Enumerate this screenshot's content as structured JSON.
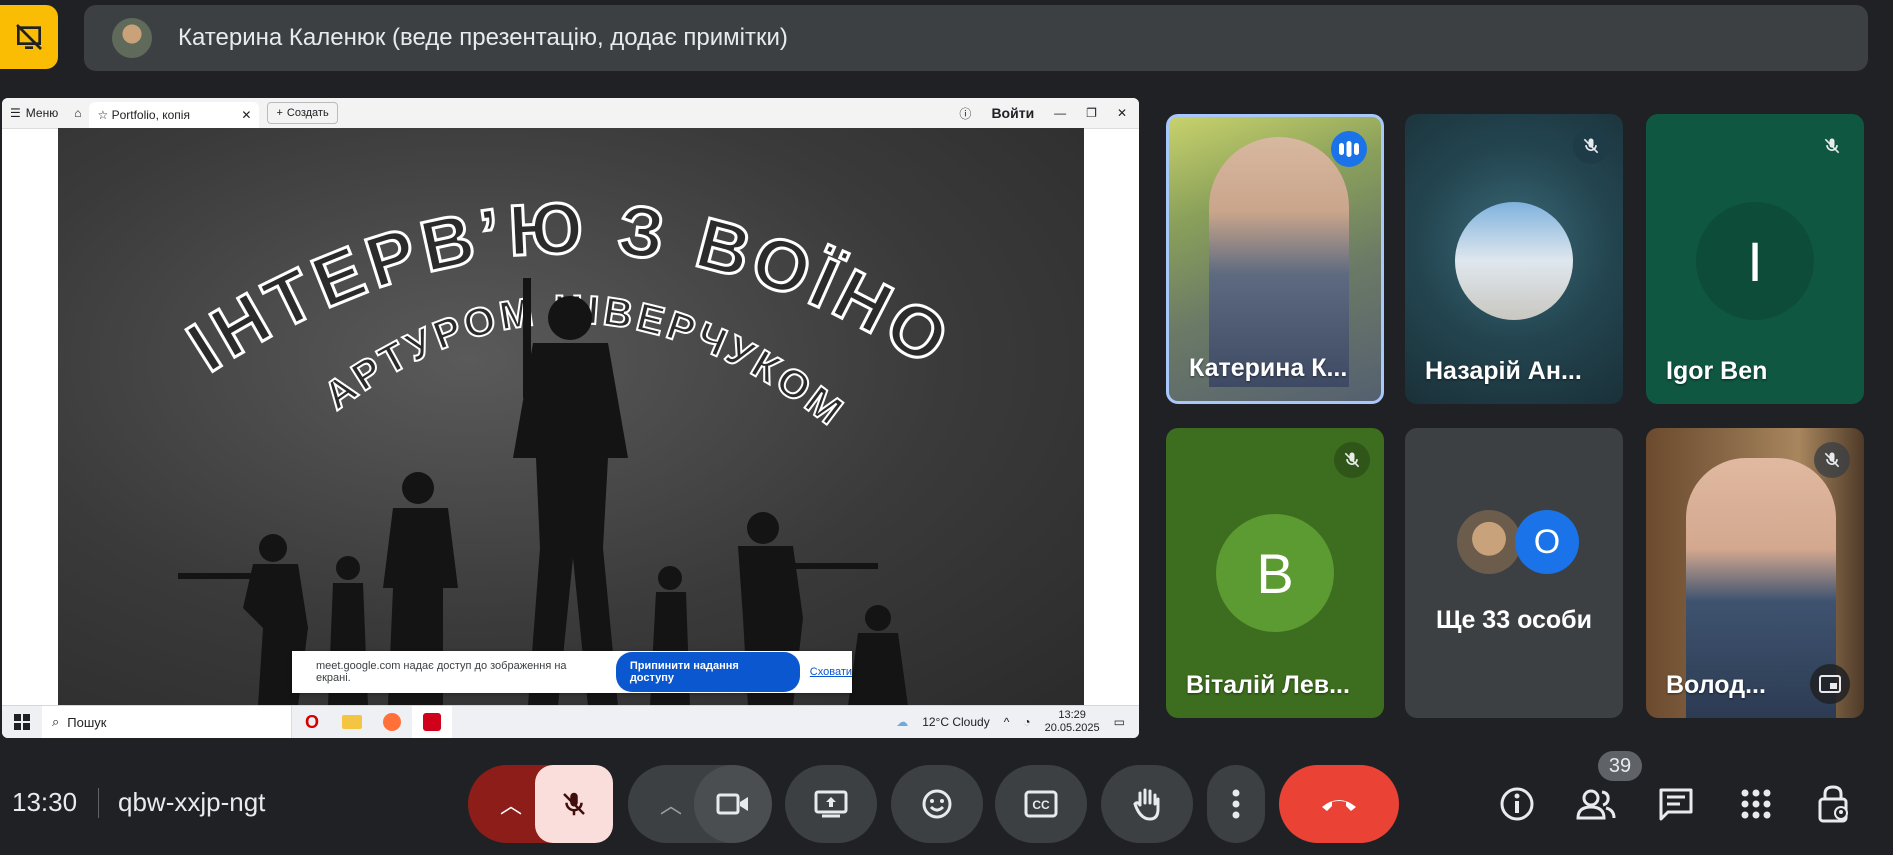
{
  "presenter": {
    "name": "Катерина Каленюк (веде презентацію, додає примітки)"
  },
  "browser": {
    "menu_label": "Меню",
    "tab_title": "Portfolio, копія",
    "create_label": "Создать",
    "login_label": "Войти"
  },
  "slide": {
    "title_line1": "ІНТЕРВ’Ю З ВОЇНОМ",
    "title_line2": "АРТУРОМ НІВЕРЧУКОМ"
  },
  "share_notice": {
    "text": "meet.google.com надає доступ до зображення на екрані.",
    "stop_label": "Припинити надання доступу",
    "hide_label": "Сховати"
  },
  "taskbar": {
    "search_placeholder": "Пошук",
    "weather": "12°C  Cloudy",
    "time": "13:29",
    "date": "20.05.2025"
  },
  "participants": [
    {
      "name": "Катерина К...",
      "state": "speaking"
    },
    {
      "name": "Назарій Ан...",
      "state": "muted"
    },
    {
      "name": "Igor Ben",
      "initial": "I",
      "state": "muted"
    },
    {
      "name": "Віталій Лев...",
      "initial": "B",
      "state": "muted"
    },
    {
      "more_label": "Ще 33 особи",
      "more_initial": "O"
    },
    {
      "name": "Volod",
      "display": "Волод...",
      "state": "muted"
    }
  ],
  "meeting": {
    "time": "13:30",
    "code": "qbw-xxjp-ngt",
    "participant_count": "39"
  },
  "colors": {
    "background": "#202124",
    "tile": "#3c4043",
    "end_call": "#ea4335",
    "mic_off_bg": "#f9dedc",
    "accent": "#fbbc04"
  }
}
